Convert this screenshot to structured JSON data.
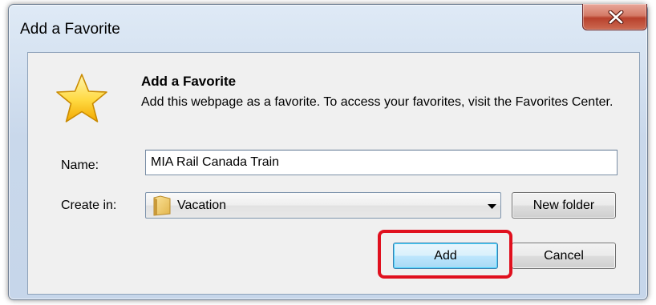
{
  "window": {
    "title": "Add a Favorite"
  },
  "dialog": {
    "heading": "Add a Favorite",
    "description": "Add this webpage as a favorite. To access your favorites, visit the Favorites Center.",
    "name_label": "Name:",
    "name_value": "MIA Rail Canada Train",
    "create_in_label": "Create in:",
    "create_in_value": "Vacation",
    "new_folder_label": "New folder",
    "add_label": "Add",
    "cancel_label": "Cancel"
  },
  "icons": {
    "star": "star-icon",
    "folder": "folder-icon",
    "close": "close-icon",
    "dropdown": "chevron-down-icon"
  },
  "colors": {
    "highlight": "#e0101e",
    "close_button": "#c4503b",
    "default_button": "#bee6fd"
  }
}
